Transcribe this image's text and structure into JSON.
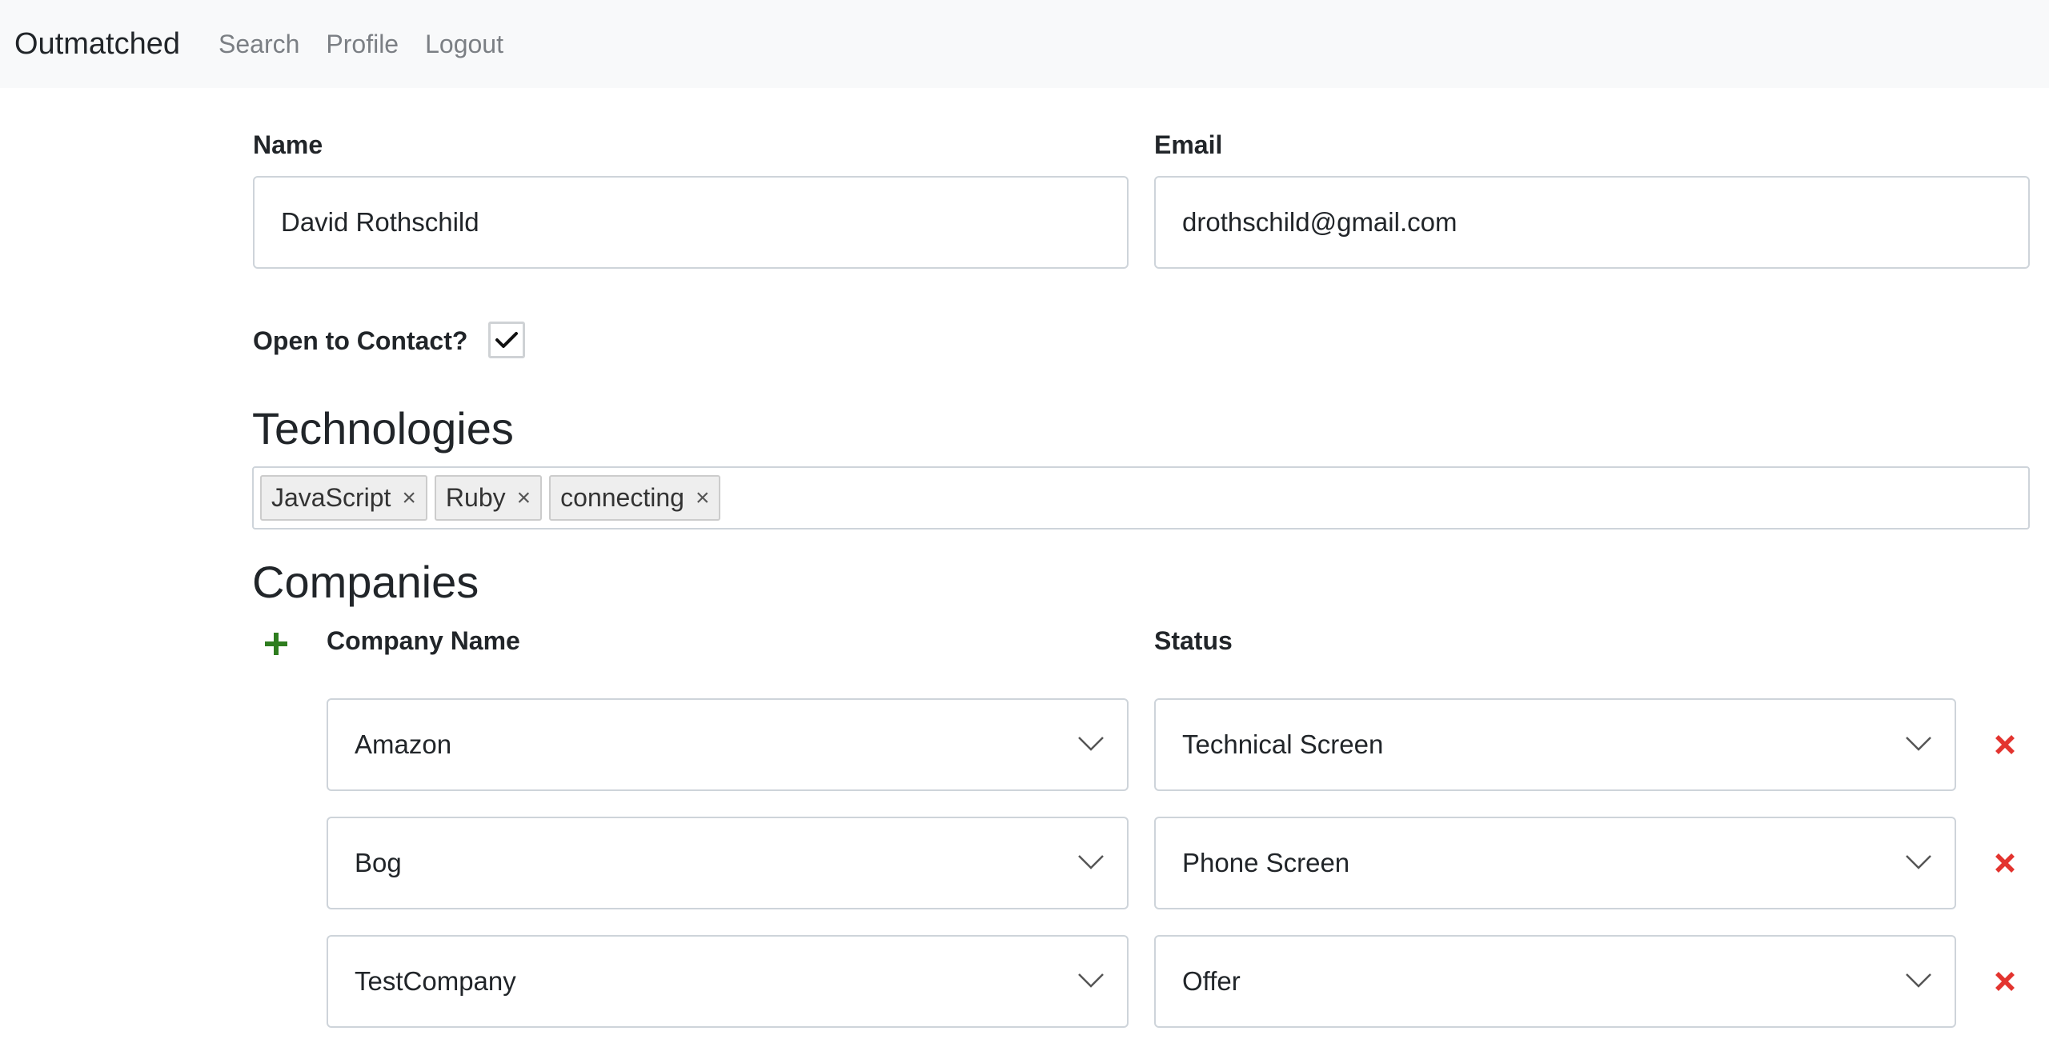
{
  "navbar": {
    "brand": "Outmatched",
    "links": [
      "Search",
      "Profile",
      "Logout"
    ]
  },
  "form": {
    "name_label": "Name",
    "name_value": "David Rothschild",
    "email_label": "Email",
    "email_value": "drothschild@gmail.com",
    "contact_label": "Open to Contact?",
    "contact_checked": true
  },
  "technologies": {
    "heading": "Technologies",
    "tags": [
      "JavaScript",
      "Ruby",
      "connecting"
    ],
    "remove_glyph": "×"
  },
  "companies": {
    "heading": "Companies",
    "company_col_label": "Company Name",
    "status_col_label": "Status",
    "rows": [
      {
        "company": "Amazon",
        "status": "Technical Screen"
      },
      {
        "company": "Bog",
        "status": "Phone Screen"
      },
      {
        "company": "TestCompany",
        "status": "Offer"
      }
    ]
  },
  "colors": {
    "add": "#2e7d1f",
    "remove": "#e3342f",
    "navbar_bg": "#f8f9fa"
  },
  "icons": {
    "add": "plus-icon",
    "remove": "x-icon",
    "dropdown": "chevron-down-icon",
    "check": "check-icon"
  }
}
